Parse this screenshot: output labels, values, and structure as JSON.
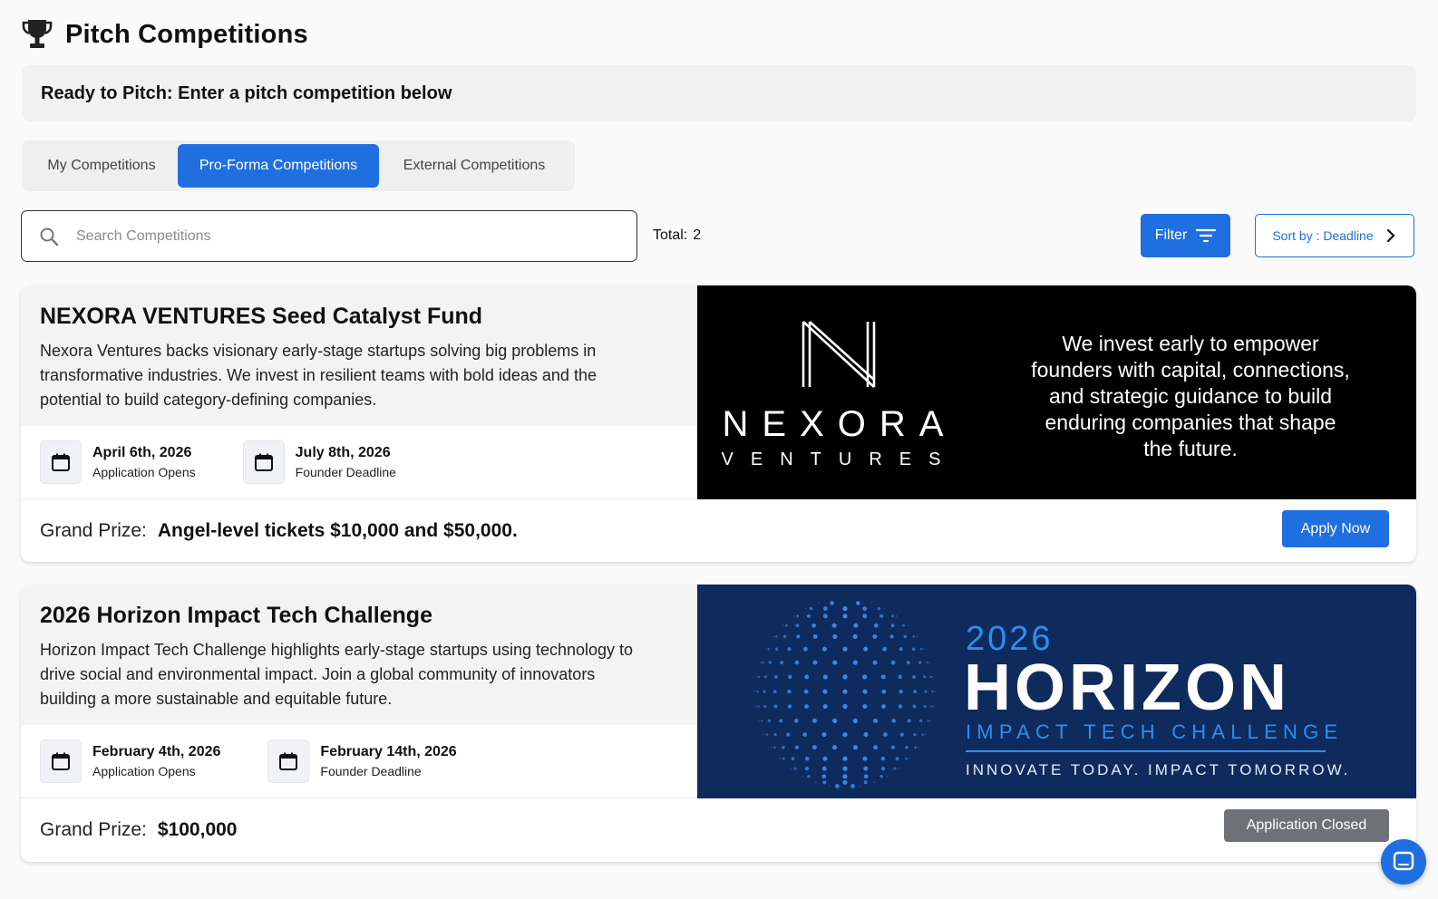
{
  "page": {
    "title": "Pitch Competitions",
    "icon": "trophy-icon"
  },
  "banner": {
    "text": "Ready to Pitch: Enter a pitch competition below"
  },
  "tabs": [
    {
      "label": "My Competitions",
      "active": false
    },
    {
      "label": "Pro-Forma Competitions",
      "active": true
    },
    {
      "label": "External Competitions",
      "active": false
    }
  ],
  "search": {
    "placeholder": "Search Competitions",
    "value": ""
  },
  "total": {
    "label": "Total:",
    "value": "2"
  },
  "toolbar": {
    "filter_label": "Filter",
    "sort_label": "Sort by : Deadline"
  },
  "colors": {
    "primary": "#1f6fe0",
    "closed": "#6e7277",
    "horizon_bg": "#0f2a5c",
    "horizon_accent": "#2b8ff0"
  },
  "competitions": [
    {
      "title": "NEXORA VENTURES Seed Catalyst Fund",
      "description": "Nexora Ventures backs visionary early-stage startups solving big problems in transformative industries. We invest in resilient teams with bold ideas and the potential to build category-defining companies.",
      "dates": [
        {
          "date": "April 6th, 2026",
          "label": "Application Opens"
        },
        {
          "date": "July 8th, 2026",
          "label": "Founder Deadline"
        }
      ],
      "prize_label": "Grand Prize:",
      "prize": "Angel-level tickets $10,000 and $50,000.",
      "action": "Apply Now",
      "image": {
        "brand_mark": "N",
        "brand_name": "NEXORA",
        "brand_sub": "VENTURES",
        "tagline_lines": [
          "We invest early to empower",
          "founders with capital, connections,",
          "and strategic guidance to build",
          "enduring companies that shape",
          "the future."
        ]
      }
    },
    {
      "title": "2026 Horizon Impact Tech Challenge",
      "description": "Horizon Impact Tech Challenge highlights early-stage startups using technology to drive social and environmental impact. Join a global community of innovators building a more sustainable and equitable future.",
      "dates": [
        {
          "date": "February 4th, 2026",
          "label": "Application Opens"
        },
        {
          "date": "February 14th, 2026",
          "label": "Founder Deadline"
        }
      ],
      "prize_label": "Grand Prize:",
      "prize": "$100,000",
      "action": "Application Closed",
      "image": {
        "year": "2026",
        "name": "HORIZON",
        "subtitle": "IMPACT TECH CHALLENGE",
        "slogan": "INNOVATE TODAY. IMPACT TOMORROW."
      }
    }
  ]
}
